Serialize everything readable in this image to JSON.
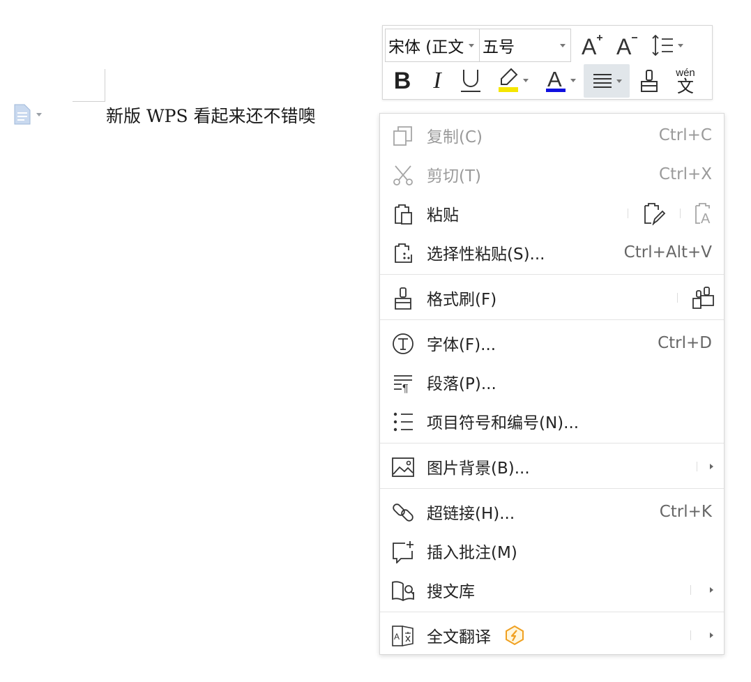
{
  "document": {
    "text": "新版 WPS 看起来还不错噢",
    "paragraph_icon": "document-paragraph-icon"
  },
  "toolbar": {
    "font_name": "宋体 (正文",
    "font_size": "五号",
    "grow_font_icon": "font-grow-icon",
    "shrink_font_icon": "font-shrink-icon",
    "line_spacing_icon": "line-spacing-icon",
    "bold_label": "B",
    "italic_label": "I",
    "underline_label": "U",
    "highlight_color": "#f5e600",
    "font_color": "#1010e0",
    "font_color_letter": "A",
    "phonetic_top": "wén",
    "phonetic_bottom": "文"
  },
  "menu": {
    "copy": {
      "label": "复制(C)",
      "shortcut": "Ctrl+C"
    },
    "cut": {
      "label": "剪切(T)",
      "shortcut": "Ctrl+X"
    },
    "paste": {
      "label": "粘贴"
    },
    "paste_special": {
      "label": "选择性粘贴(S)...",
      "shortcut": "Ctrl+Alt+V"
    },
    "format_painter": {
      "label": "格式刷(F)"
    },
    "font": {
      "label": "字体(F)...",
      "shortcut": "Ctrl+D"
    },
    "paragraph": {
      "label": "段落(P)..."
    },
    "bullets": {
      "label": "项目符号和编号(N)..."
    },
    "picture_background": {
      "label": "图片背景(B)..."
    },
    "hyperlink": {
      "label": "超链接(H)...",
      "shortcut": "Ctrl+K"
    },
    "insert_comment": {
      "label": "插入批注(M)"
    },
    "search_library": {
      "label": "搜文库"
    },
    "translate": {
      "label": "全文翻译",
      "badge_color": "#f0a020"
    }
  }
}
